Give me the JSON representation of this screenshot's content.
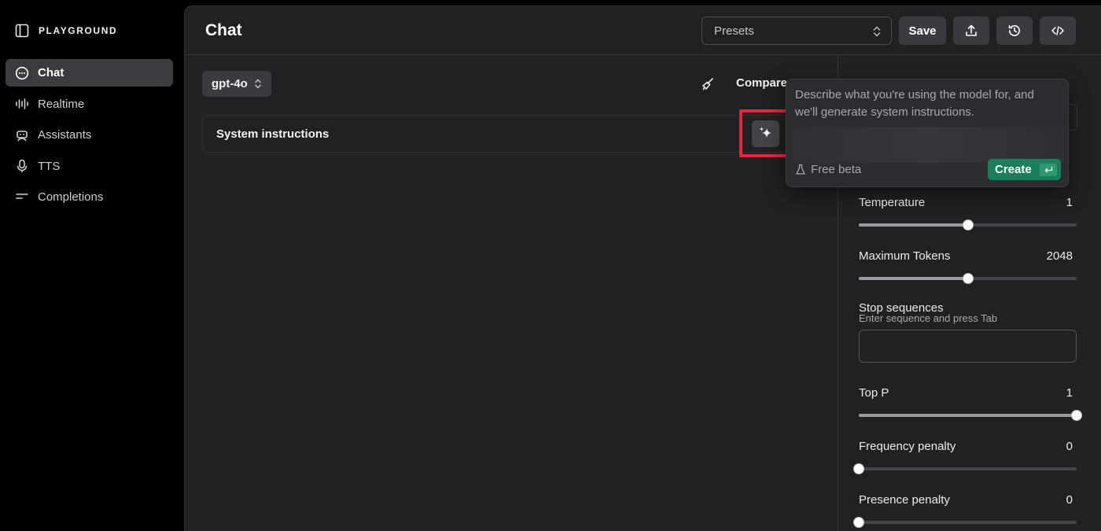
{
  "sidebar": {
    "brand": "PLAYGROUND",
    "items": [
      {
        "label": "Chat",
        "icon": "chat-bubble-icon",
        "active": true
      },
      {
        "label": "Realtime",
        "icon": "waveform-icon",
        "active": false
      },
      {
        "label": "Assistants",
        "icon": "robot-icon",
        "active": false
      },
      {
        "label": "TTS",
        "icon": "microphone-icon",
        "active": false
      },
      {
        "label": "Completions",
        "icon": "lines-icon",
        "active": false
      }
    ]
  },
  "header": {
    "title": "Chat",
    "presets_placeholder": "Presets",
    "save_label": "Save"
  },
  "chat": {
    "model": "gpt-4o",
    "compare_label": "Compare",
    "system_instructions_label": "System instructions"
  },
  "popover": {
    "description": "Describe what you're using the model for, and we'll generate system instructions.",
    "free_beta": "Free beta",
    "create_label": "Create"
  },
  "settings": {
    "temperature": {
      "label": "Temperature",
      "value": "1",
      "fraction": 0.5
    },
    "max_tokens": {
      "label": "Maximum Tokens",
      "value": "2048",
      "fraction": 0.5
    },
    "stop_sequences": {
      "label": "Stop sequences",
      "hint": "Enter sequence and press Tab"
    },
    "top_p": {
      "label": "Top P",
      "value": "1",
      "fraction": 1.0
    },
    "frequency_penalty": {
      "label": "Frequency penalty",
      "value": "0",
      "fraction": 0.0
    },
    "presence_penalty": {
      "label": "Presence penalty",
      "value": "0",
      "fraction": 0.0
    }
  },
  "colors": {
    "accent_green": "#1a7f5a",
    "highlight_red": "#e5273b"
  }
}
